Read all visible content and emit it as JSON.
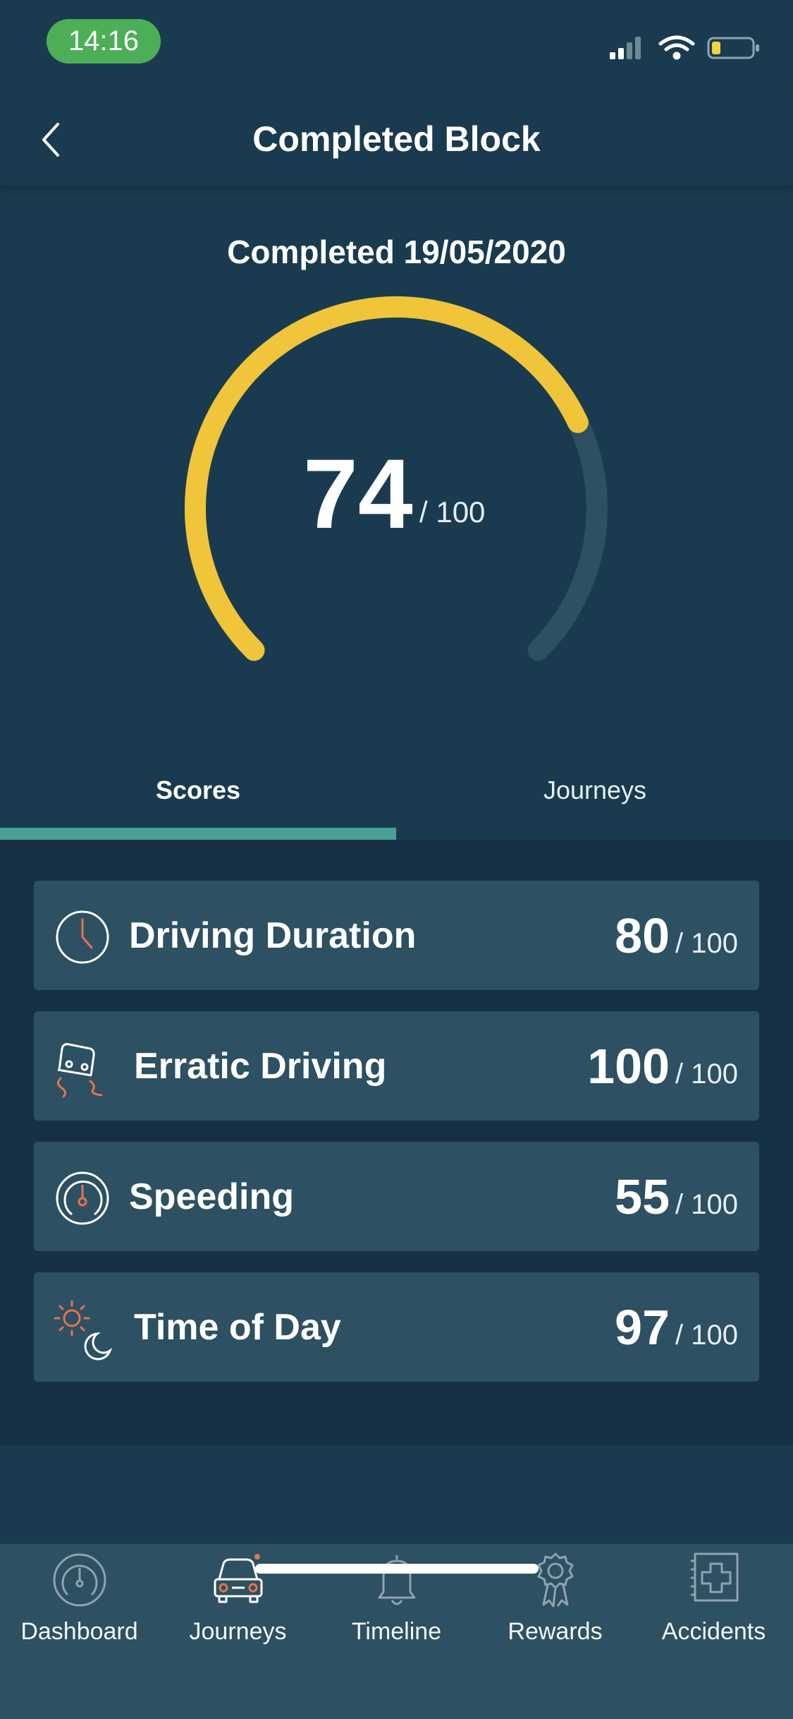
{
  "status_bar": {
    "time": "14:16"
  },
  "header": {
    "title": "Completed Block"
  },
  "summary": {
    "completed_label": "Completed 19/05/2020",
    "score": "74",
    "max": "/ 100",
    "score_fraction": 0.74,
    "colors": {
      "arc": "#f0c53a",
      "track": "#2d5062"
    }
  },
  "tabs": [
    {
      "label": "Scores",
      "active": true
    },
    {
      "label": "Journeys",
      "active": false
    }
  ],
  "scores": [
    {
      "label": "Driving Duration",
      "value": "80",
      "max": "/ 100",
      "icon": "clock-icon"
    },
    {
      "label": "Erratic Driving",
      "value": "100",
      "max": "/ 100",
      "icon": "skidding-car-icon"
    },
    {
      "label": "Speeding",
      "value": "55",
      "max": "/ 100",
      "icon": "speedometer-icon"
    },
    {
      "label": "Time of Day",
      "value": "97",
      "max": "/ 100",
      "icon": "sun-moon-icon"
    }
  ],
  "bottom_nav": [
    {
      "label": "Dashboard",
      "icon": "dashboard-icon"
    },
    {
      "label": "Journeys",
      "icon": "car-icon"
    },
    {
      "label": "Timeline",
      "icon": "bell-icon"
    },
    {
      "label": "Rewards",
      "icon": "rosette-icon"
    },
    {
      "label": "Accidents",
      "icon": "first-aid-icon"
    }
  ],
  "colors": {
    "accent": "#48a093",
    "orange": "#e8734a",
    "background": "#1a3b4f",
    "card": "#2d5062"
  }
}
